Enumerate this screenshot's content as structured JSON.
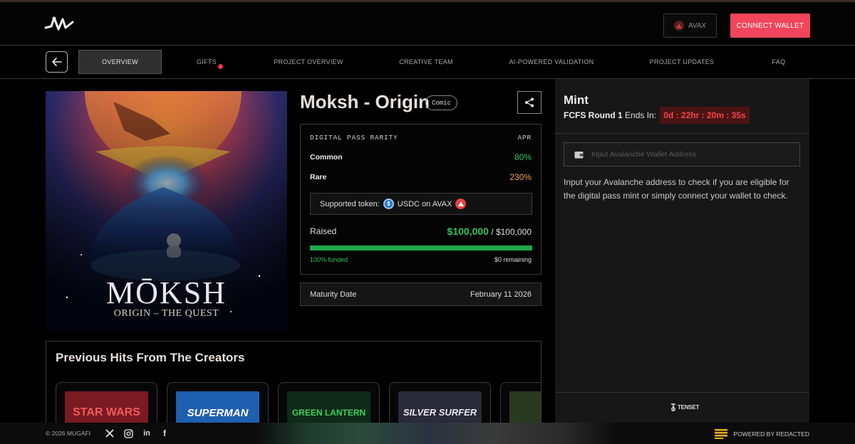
{
  "header": {
    "network_label": "AVAX",
    "connect_label": "CONNECT WALLET"
  },
  "nav": {
    "tabs": [
      {
        "label": "OVERVIEW",
        "active": true
      },
      {
        "label": "GIFTS",
        "badge": true
      },
      {
        "label": "PROJECT OVERVIEW"
      },
      {
        "label": "CREATIVE TEAM"
      },
      {
        "label": "AI-POWERED VALIDATION"
      },
      {
        "label": "PROJECT UPDATES"
      },
      {
        "label": "FAQ"
      }
    ]
  },
  "cover": {
    "title": "MŌKSH",
    "subtitle": "ORIGIN – THE QUEST"
  },
  "project": {
    "title": "Moksh - Origin",
    "tag": "Comic"
  },
  "rarity": {
    "header_left": "DIGITAL PASS RARITY",
    "header_right": "APR",
    "rows": [
      {
        "label": "Common",
        "value": "80%",
        "color": "#35c25c"
      },
      {
        "label": "Rare",
        "value": "230%",
        "color": "#f0a050"
      }
    ],
    "token_prefix": "Supported token:",
    "token_name": "USDC on AVAX",
    "raised_label": "Raised",
    "raised_amount": "$100,000",
    "raised_total": "/ $100,000",
    "progress": 1.0,
    "funded_text": "100% funded",
    "remaining_text": "$0 remaining"
  },
  "maturity": {
    "label": "Maturity Date",
    "value": "February 11 2026"
  },
  "previous_hits": {
    "title": "Previous Hits From The Creators",
    "items": [
      {
        "text": "STAR WARS",
        "bg": "#7a1a22",
        "fg": "#f05a5a"
      },
      {
        "text": "SUPERMAN",
        "bg": "#1f5fb0",
        "fg": "#ffffff"
      },
      {
        "text": "GREEN LANTERN",
        "bg": "#0f2a18",
        "fg": "#3fd05a"
      },
      {
        "text": "SILVER SURFER",
        "bg": "#2a2a3a",
        "fg": "#e8e8f0"
      },
      {
        "text": "",
        "bg": "#2a3a20",
        "fg": "#e8e8f0"
      }
    ]
  },
  "mint": {
    "title": "Mint",
    "round_label": "FCFS Round 1",
    "ends_label": "Ends In:",
    "countdown": "0d : 22hr : 20m : 35s",
    "input_placeholder": "Input Avalanche Wallet Address",
    "description": "Input your Avalanche address to check if you are eligible for the digital pass mint or simply connect your wallet to check.",
    "partner": "TENSET"
  },
  "footer": {
    "copyright": "© 2026 MUGAFI",
    "powered": "POWERED BY REDACTED",
    "social_icons": [
      "x-icon",
      "instagram-icon",
      "linkedin-icon",
      "facebook-icon"
    ]
  }
}
